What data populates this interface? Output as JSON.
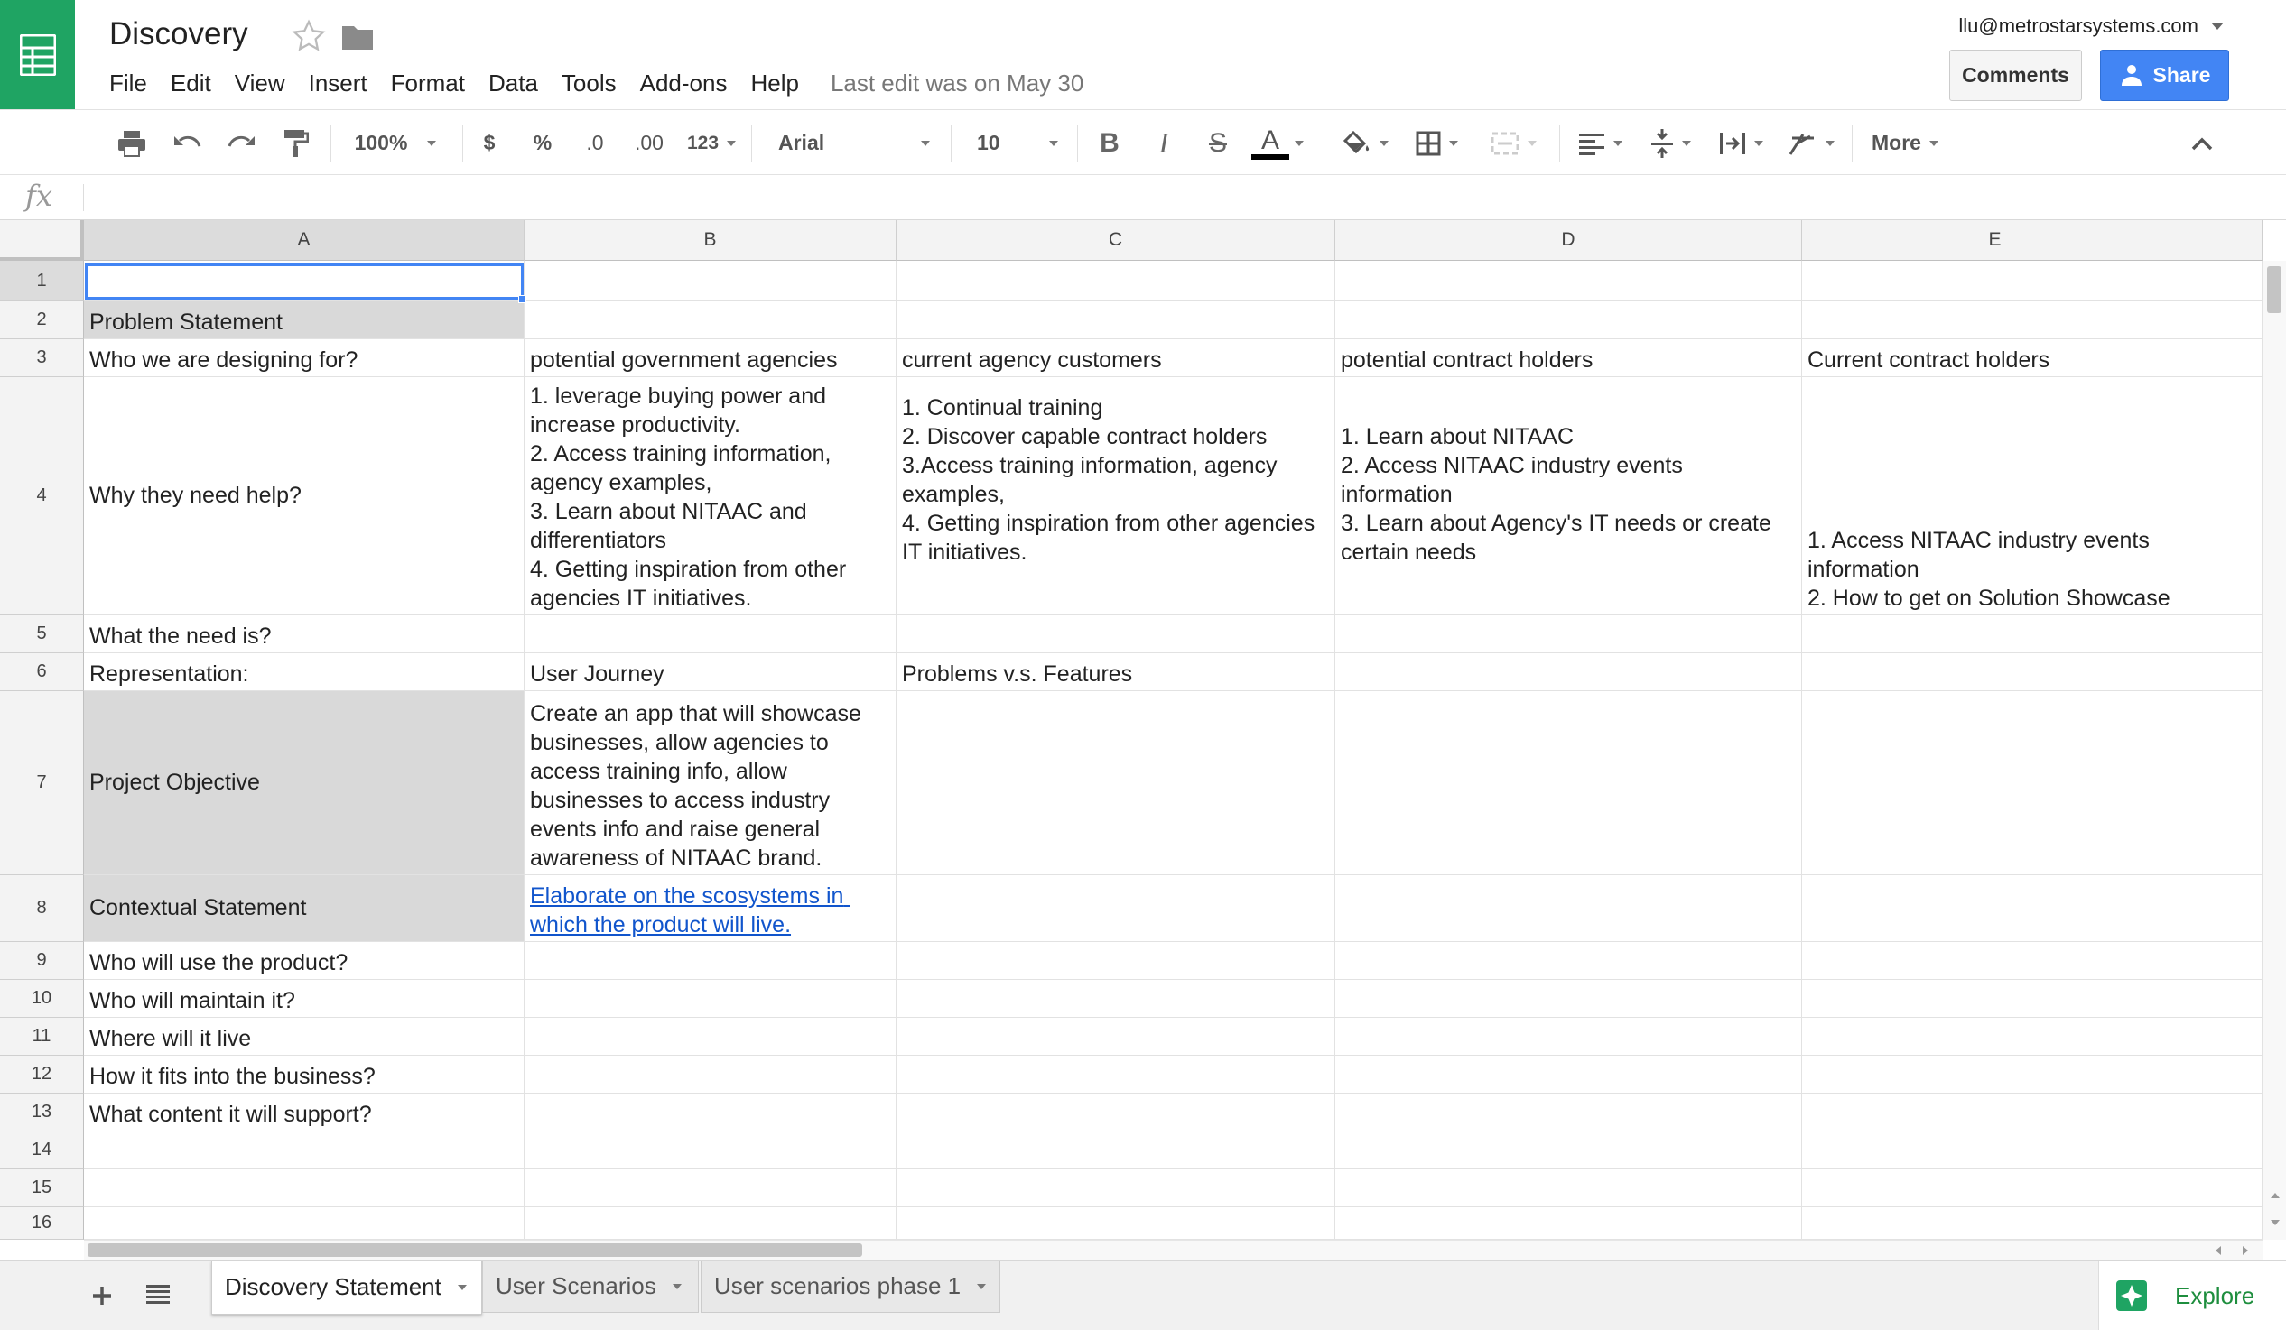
{
  "doc": {
    "title": "Discovery",
    "account": "llu@metrostarsystems.com",
    "last_edit": "Last edit was on May 30"
  },
  "menu": [
    "File",
    "Edit",
    "View",
    "Insert",
    "Format",
    "Data",
    "Tools",
    "Add-ons",
    "Help"
  ],
  "buttons": {
    "comments": "Comments",
    "share": "Share",
    "explore": "Explore"
  },
  "toolbar": {
    "zoom": "100%",
    "currency": "$",
    "percent": "%",
    "decrease_decimal": ".0",
    "increase_decimal": ".00",
    "number_format": "123",
    "font": "Arial",
    "font_size": "10",
    "bold": "B",
    "italic": "I",
    "strike": "S",
    "text_color": "A",
    "more": "More",
    "text_color_value": "#000000"
  },
  "formula": {
    "label": "fx",
    "value": ""
  },
  "columns": [
    "A",
    "B",
    "C",
    "D",
    "E"
  ],
  "rows": [
    "1",
    "2",
    "3",
    "4",
    "5",
    "6",
    "7",
    "8",
    "9",
    "10",
    "11",
    "12",
    "13",
    "14",
    "15",
    "16"
  ],
  "cells": {
    "A2": "Problem Statement",
    "A3": "Who we are designing for?",
    "B3": "potential government agencies",
    "C3": "current agency customers",
    "D3": "potential contract holders",
    "E3": "Current contract holders",
    "A4": "Why they need help?",
    "B4": "1. leverage buying power and increase productivity.\n2. Access training information, agency examples,\n3. Learn about NITAAC and differentiators\n4. Getting inspiration from other agencies IT initiatives.",
    "C4": "1. Continual training\n2. Discover capable contract holders\n3.Access training information, agency examples,\n4. Getting inspiration from other agencies IT initiatives.",
    "D4": "1. Learn about NITAAC\n2. Access NITAAC industry events information\n3. Learn about Agency's IT needs or create certain needs",
    "E4": "1. Access NITAAC industry events information\n2. How to get on Solution Showcase",
    "A5": "What the need is?",
    "A6": "Representation:",
    "B6": "User Journey",
    "C6": "Problems v.s. Features",
    "A7": "Project Objective",
    "B7": "Create an app that will showcase businesses, allow agencies to access training info, allow businesses to access industry events info and raise general awareness of NITAAC brand.",
    "A8": "Contextual Statement",
    "B8": "Elaborate on the scosystems in which the product will live.",
    "A9": "Who will use the product?",
    "A10": "Who will maintain it?",
    "A11": "Where will it live",
    "A12": "How it fits into the business?",
    "A13": "What content it will support?"
  },
  "sheets": [
    "Discovery Statement",
    "User Scenarios",
    "User scenarios phase 1"
  ],
  "colors": {
    "brand_green": "#1fa463",
    "share_blue": "#4285f4",
    "link_blue": "#1155cc",
    "header_gray": "#d9d9d9"
  }
}
